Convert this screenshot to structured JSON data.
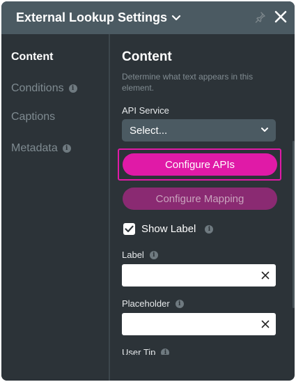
{
  "header": {
    "title": "External Lookup Settings"
  },
  "sidebar": {
    "items": [
      {
        "label": "Content",
        "active": true,
        "info": false
      },
      {
        "label": "Conditions",
        "active": false,
        "info": true
      },
      {
        "label": "Captions",
        "active": false,
        "info": false
      },
      {
        "label": "Metadata",
        "active": false,
        "info": true
      }
    ]
  },
  "content": {
    "title": "Content",
    "description": "Determine what text appears in this element.",
    "api_service": {
      "label": "API Service",
      "selected": "Select..."
    },
    "configure_apis_label": "Configure APIs",
    "configure_mapping_label": "Configure Mapping",
    "show_label": {
      "label": "Show Label",
      "checked": true
    },
    "label_field": {
      "label": "Label",
      "value": ""
    },
    "placeholder_field": {
      "label": "Placeholder",
      "value": ""
    },
    "user_tip_label": "User Tip"
  },
  "colors": {
    "header_bg": "#4b5a62",
    "panel_bg": "#2c3338",
    "accent": "#e01aa7",
    "accent_disabled": "#8a2a72"
  }
}
